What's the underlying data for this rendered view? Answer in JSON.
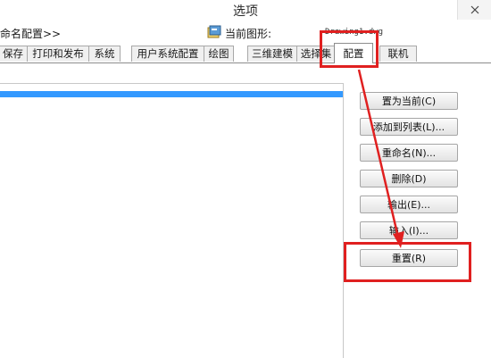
{
  "window": {
    "title": "选项"
  },
  "header": {
    "profile_label": "命名配置>>",
    "drawing_label": "当前图形:",
    "drawing_value": "Drawing1.dwg"
  },
  "tabs": [
    {
      "label": "保存"
    },
    {
      "label": "打印和发布"
    },
    {
      "label": "系统"
    },
    {
      "label": "用户系统配置"
    },
    {
      "label": "绘图"
    },
    {
      "label": "三维建模"
    },
    {
      "label": "选择集"
    },
    {
      "label": "配置",
      "active": true
    },
    {
      "label": "联机"
    }
  ],
  "buttons": {
    "set_current": "置为当前(C)",
    "add_to_list": "添加到列表(L)...",
    "rename": "重命名(N)...",
    "delete": "删除(D)",
    "export": "输出(E)...",
    "import": "输入(I)...",
    "reset": "重置(R)"
  },
  "colors": {
    "highlight": "#e02020",
    "selection": "#3399ff"
  }
}
